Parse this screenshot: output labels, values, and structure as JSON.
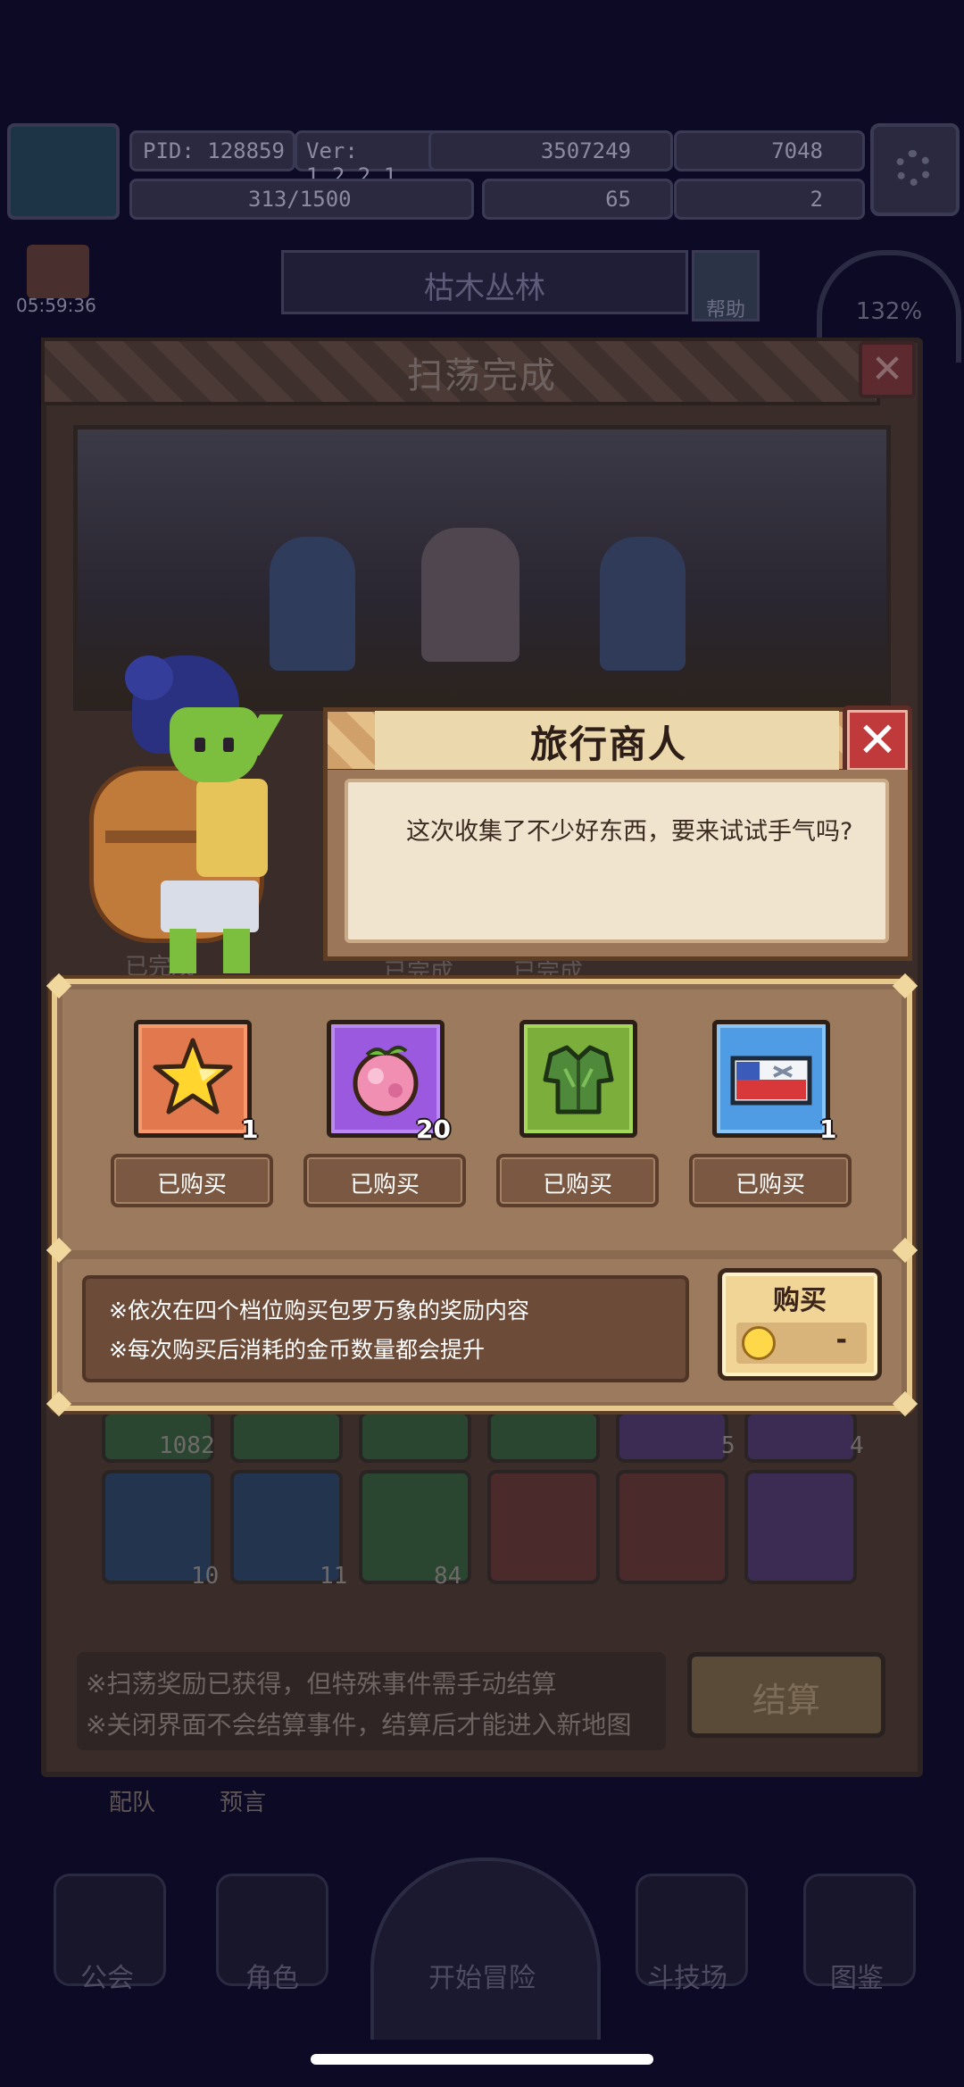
{
  "topbar": {
    "pid": "PID: 128859",
    "version": "Ver: 1.2.2.1",
    "gold": "3507249",
    "gems": "7048",
    "exp": "313/1500",
    "clover": "65",
    "keys": "2"
  },
  "map": {
    "name": "枯木丛林",
    "help_label": "帮助",
    "timer": "05:59:36",
    "efficiency": "132%"
  },
  "sweep": {
    "title": "扫荡完成",
    "status_done": "已完成",
    "grid_counts": [
      "1082",
      "5",
      "4",
      "10",
      "11",
      "84"
    ],
    "footer_lines": [
      "※扫荡奖励已获得，但特殊事件需手动结算",
      "※关闭界面不会结算事件，结算后才能进入新地图"
    ],
    "settle_label": "结算",
    "team_tab": "配队",
    "preview_tab": "预言"
  },
  "merchant": {
    "title": "旅行商人",
    "dialog": "这次收集了不少好东西，要来试试手气吗?",
    "items": [
      {
        "icon": "star-icon",
        "qty": "1",
        "status": "已购买",
        "color": "orange"
      },
      {
        "icon": "fruit-icon",
        "qty": "20",
        "status": "已购买",
        "color": "purple"
      },
      {
        "icon": "armor-icon",
        "qty": "",
        "status": "已购买",
        "color": "green"
      },
      {
        "icon": "ticket-icon",
        "qty": "1",
        "status": "已购买",
        "color": "blue"
      }
    ],
    "rules": [
      "※依次在四个档位购买包罗万象的奖励内容",
      "※每次购买后消耗的金币数量都会提升"
    ],
    "buy_label": "购买",
    "price": "-"
  },
  "nav": {
    "items": [
      "公会",
      "角色",
      "开始冒险",
      "斗技场",
      "图鉴"
    ]
  }
}
